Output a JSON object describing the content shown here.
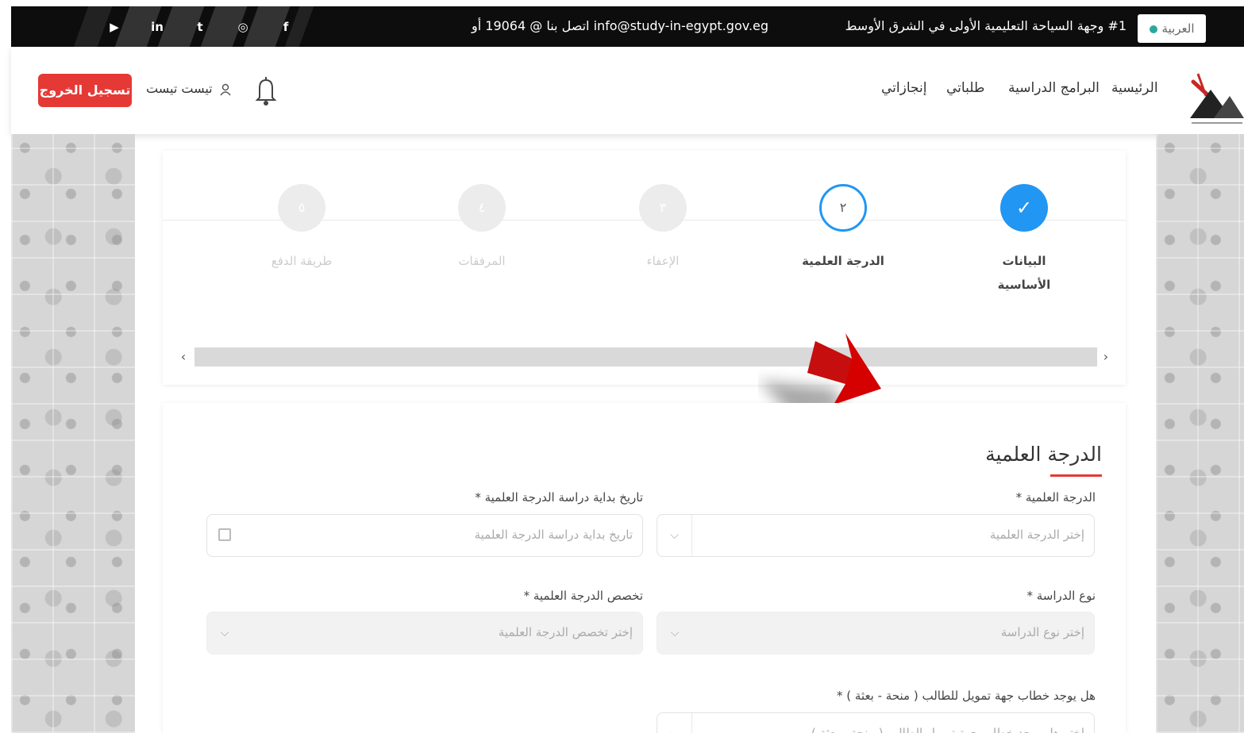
{
  "topbar": {
    "language": "العربية",
    "tagline": "#1 وجهة السياحة التعليمية الأولى في الشرق الأوسط",
    "contact": "اتصل بنا @ 19064 أو info@study-in-egypt.gov.eg",
    "social": [
      "f-icon",
      "instagram-icon",
      "twitter-icon",
      "linkedin-icon",
      "youtube-icon"
    ],
    "social_glyphs": [
      "f",
      "◎",
      "t",
      "in",
      "▶"
    ]
  },
  "nav": {
    "home": "الرئيسية",
    "programs": "البرامج الدراسية",
    "applications": "طلباتي",
    "achievements": "إنجازاتي",
    "user_name": "تيست تيست",
    "logout": "تسجيل الخروج"
  },
  "stepper": {
    "steps": [
      {
        "label": "البيانات الأساسية",
        "number": "✓",
        "state": "done"
      },
      {
        "label": "الدرجة العلمية",
        "number": "٢",
        "state": "active"
      },
      {
        "label": "الإعفاء",
        "number": "٣",
        "state": "pending"
      },
      {
        "label": "المرفقات",
        "number": "٤",
        "state": "pending"
      },
      {
        "label": "طريقة الدفع",
        "number": "٥",
        "state": "pending"
      }
    ],
    "scroll_left": "‹",
    "scroll_right": "›"
  },
  "form": {
    "title": "الدرجة العلمية",
    "degree_label": "الدرجة العلمية *",
    "degree_placeholder": "إختر الدرجة العلمية",
    "start_date_label": "تاريخ بداية دراسة الدرجة العلمية *",
    "start_date_placeholder": "تاريخ بداية دراسة الدرجة العلمية",
    "study_type_label": "نوع الدراسة *",
    "study_type_placeholder": "إختر نوع الدراسة",
    "specialization_label": "تخصص الدرجة العلمية *",
    "specialization_placeholder": "إختر تخصص الدرجة العلمية",
    "funding_label": "هل يوجد خطاب جهة تمويل للطالب ( منحة - بعثة ) *",
    "funding_placeholder": "إختر هل يوجد خطاب جهة تمويل الطالب ( منحة - بعثة )",
    "chevron": "⌵"
  },
  "colors": {
    "accent_blue": "#2196f3",
    "logout_red": "#e53935",
    "topbar_black": "#0d0d0d"
  }
}
